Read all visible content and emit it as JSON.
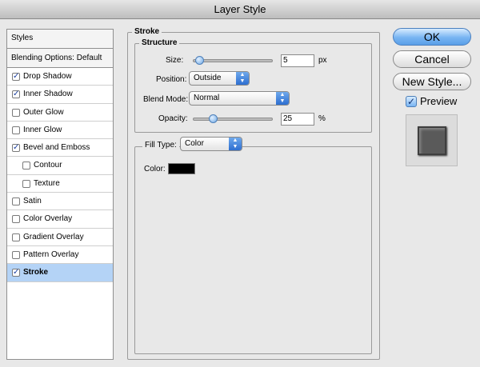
{
  "window": {
    "title": "Layer Style"
  },
  "styles_panel": {
    "header": "Styles",
    "blending_options": "Blending Options: Default",
    "items": [
      {
        "label": "Drop Shadow",
        "checked": true,
        "indent": false,
        "selected": false
      },
      {
        "label": "Inner Shadow",
        "checked": true,
        "indent": false,
        "selected": false
      },
      {
        "label": "Outer Glow",
        "checked": false,
        "indent": false,
        "selected": false
      },
      {
        "label": "Inner Glow",
        "checked": false,
        "indent": false,
        "selected": false
      },
      {
        "label": "Bevel and Emboss",
        "checked": true,
        "indent": false,
        "selected": false
      },
      {
        "label": "Contour",
        "checked": false,
        "indent": true,
        "selected": false
      },
      {
        "label": "Texture",
        "checked": false,
        "indent": true,
        "selected": false
      },
      {
        "label": "Satin",
        "checked": false,
        "indent": false,
        "selected": false
      },
      {
        "label": "Color Overlay",
        "checked": false,
        "indent": false,
        "selected": false
      },
      {
        "label": "Gradient Overlay",
        "checked": false,
        "indent": false,
        "selected": false
      },
      {
        "label": "Pattern Overlay",
        "checked": false,
        "indent": false,
        "selected": false
      },
      {
        "label": "Stroke",
        "checked": true,
        "indent": false,
        "selected": true
      }
    ]
  },
  "stroke": {
    "title": "Stroke",
    "structure": {
      "title": "Structure",
      "size_label": "Size:",
      "size_value": "5",
      "size_unit": "px",
      "size_slider_fraction": 0.05,
      "position_label": "Position:",
      "position_value": "Outside",
      "blend_mode_label": "Blend Mode:",
      "blend_mode_value": "Normal",
      "opacity_label": "Opacity:",
      "opacity_value": "25",
      "opacity_unit": "%",
      "opacity_slider_fraction": 0.25
    },
    "fill": {
      "fill_type_label": "Fill Type:",
      "fill_type_value": "Color",
      "color_label": "Color:",
      "color_value": "#000000"
    }
  },
  "buttons": {
    "ok": "OK",
    "cancel": "Cancel",
    "new_style": "New Style...",
    "preview_label": "Preview",
    "preview_checked": true
  },
  "colors": {
    "selection": "#b4d3f6",
    "accent": "#5a9fe8"
  }
}
